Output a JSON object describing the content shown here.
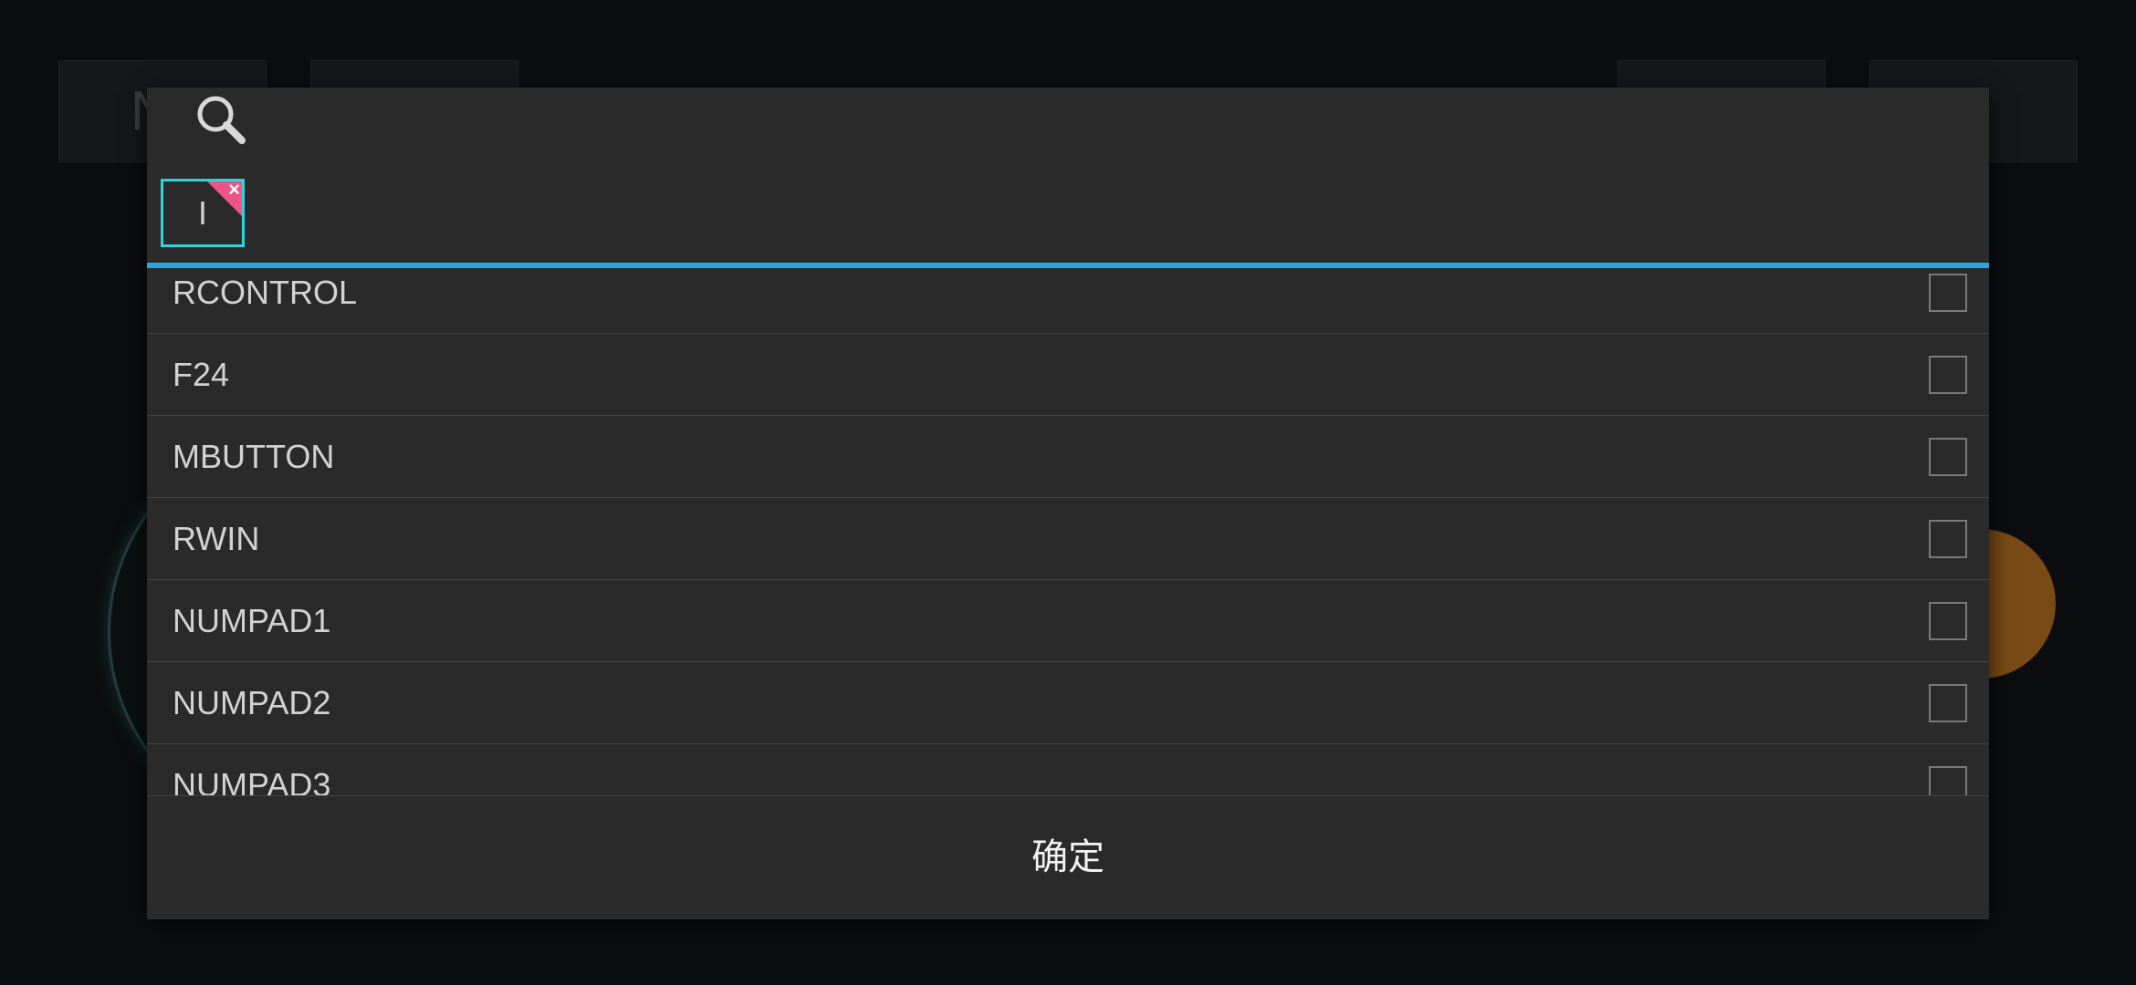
{
  "background": {
    "top_left_button_letter": "N"
  },
  "dialog": {
    "search_chip_text": "I",
    "chip_remove_glyph": "×",
    "items": [
      {
        "label": "RCONTROL",
        "checked": false
      },
      {
        "label": "F24",
        "checked": false
      },
      {
        "label": "MBUTTON",
        "checked": false
      },
      {
        "label": "RWIN",
        "checked": false
      },
      {
        "label": "NUMPAD1",
        "checked": false
      },
      {
        "label": "NUMPAD2",
        "checked": false
      },
      {
        "label": "NUMPAD3",
        "checked": false
      }
    ],
    "confirm_label": "确定"
  },
  "colors": {
    "accent": "#2aa6dc",
    "chip_border": "#2fd3dc",
    "chip_remove": "#ef5488",
    "dialog_bg": "#2a2a2a"
  }
}
